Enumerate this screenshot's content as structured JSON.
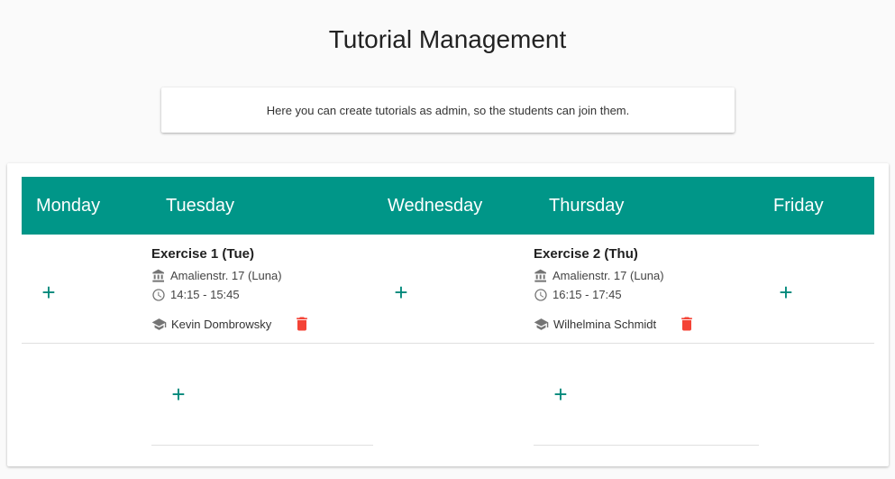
{
  "page": {
    "title": "Tutorial Management",
    "info_text": "Here you can create tutorials as admin, so the students can join them."
  },
  "colors": {
    "header": "#009688",
    "accent": "#00897b",
    "delete": "#f44336"
  },
  "days": [
    "Monday",
    "Tuesday",
    "Wednesday",
    "Thursday",
    "Friday"
  ],
  "tutorials": [
    {
      "title": "Exercise 1 (Tue)",
      "location": "Amalienstr. 17 (Luna)",
      "time": "14:15 - 15:45",
      "tutor": "Kevin Dombrowsky",
      "icons": [
        "building-icon",
        "clock-icon",
        "graduation-cap-icon",
        "trash-icon"
      ]
    },
    {
      "title": "Exercise 2 (Thu)",
      "location": "Amalienstr. 17 (Luna)",
      "time": "16:15 - 17:45",
      "tutor": "Wilhelmina Schmidt",
      "icons": [
        "building-icon",
        "clock-icon",
        "graduation-cap-icon",
        "trash-icon"
      ]
    }
  ],
  "add_symbol": "+"
}
